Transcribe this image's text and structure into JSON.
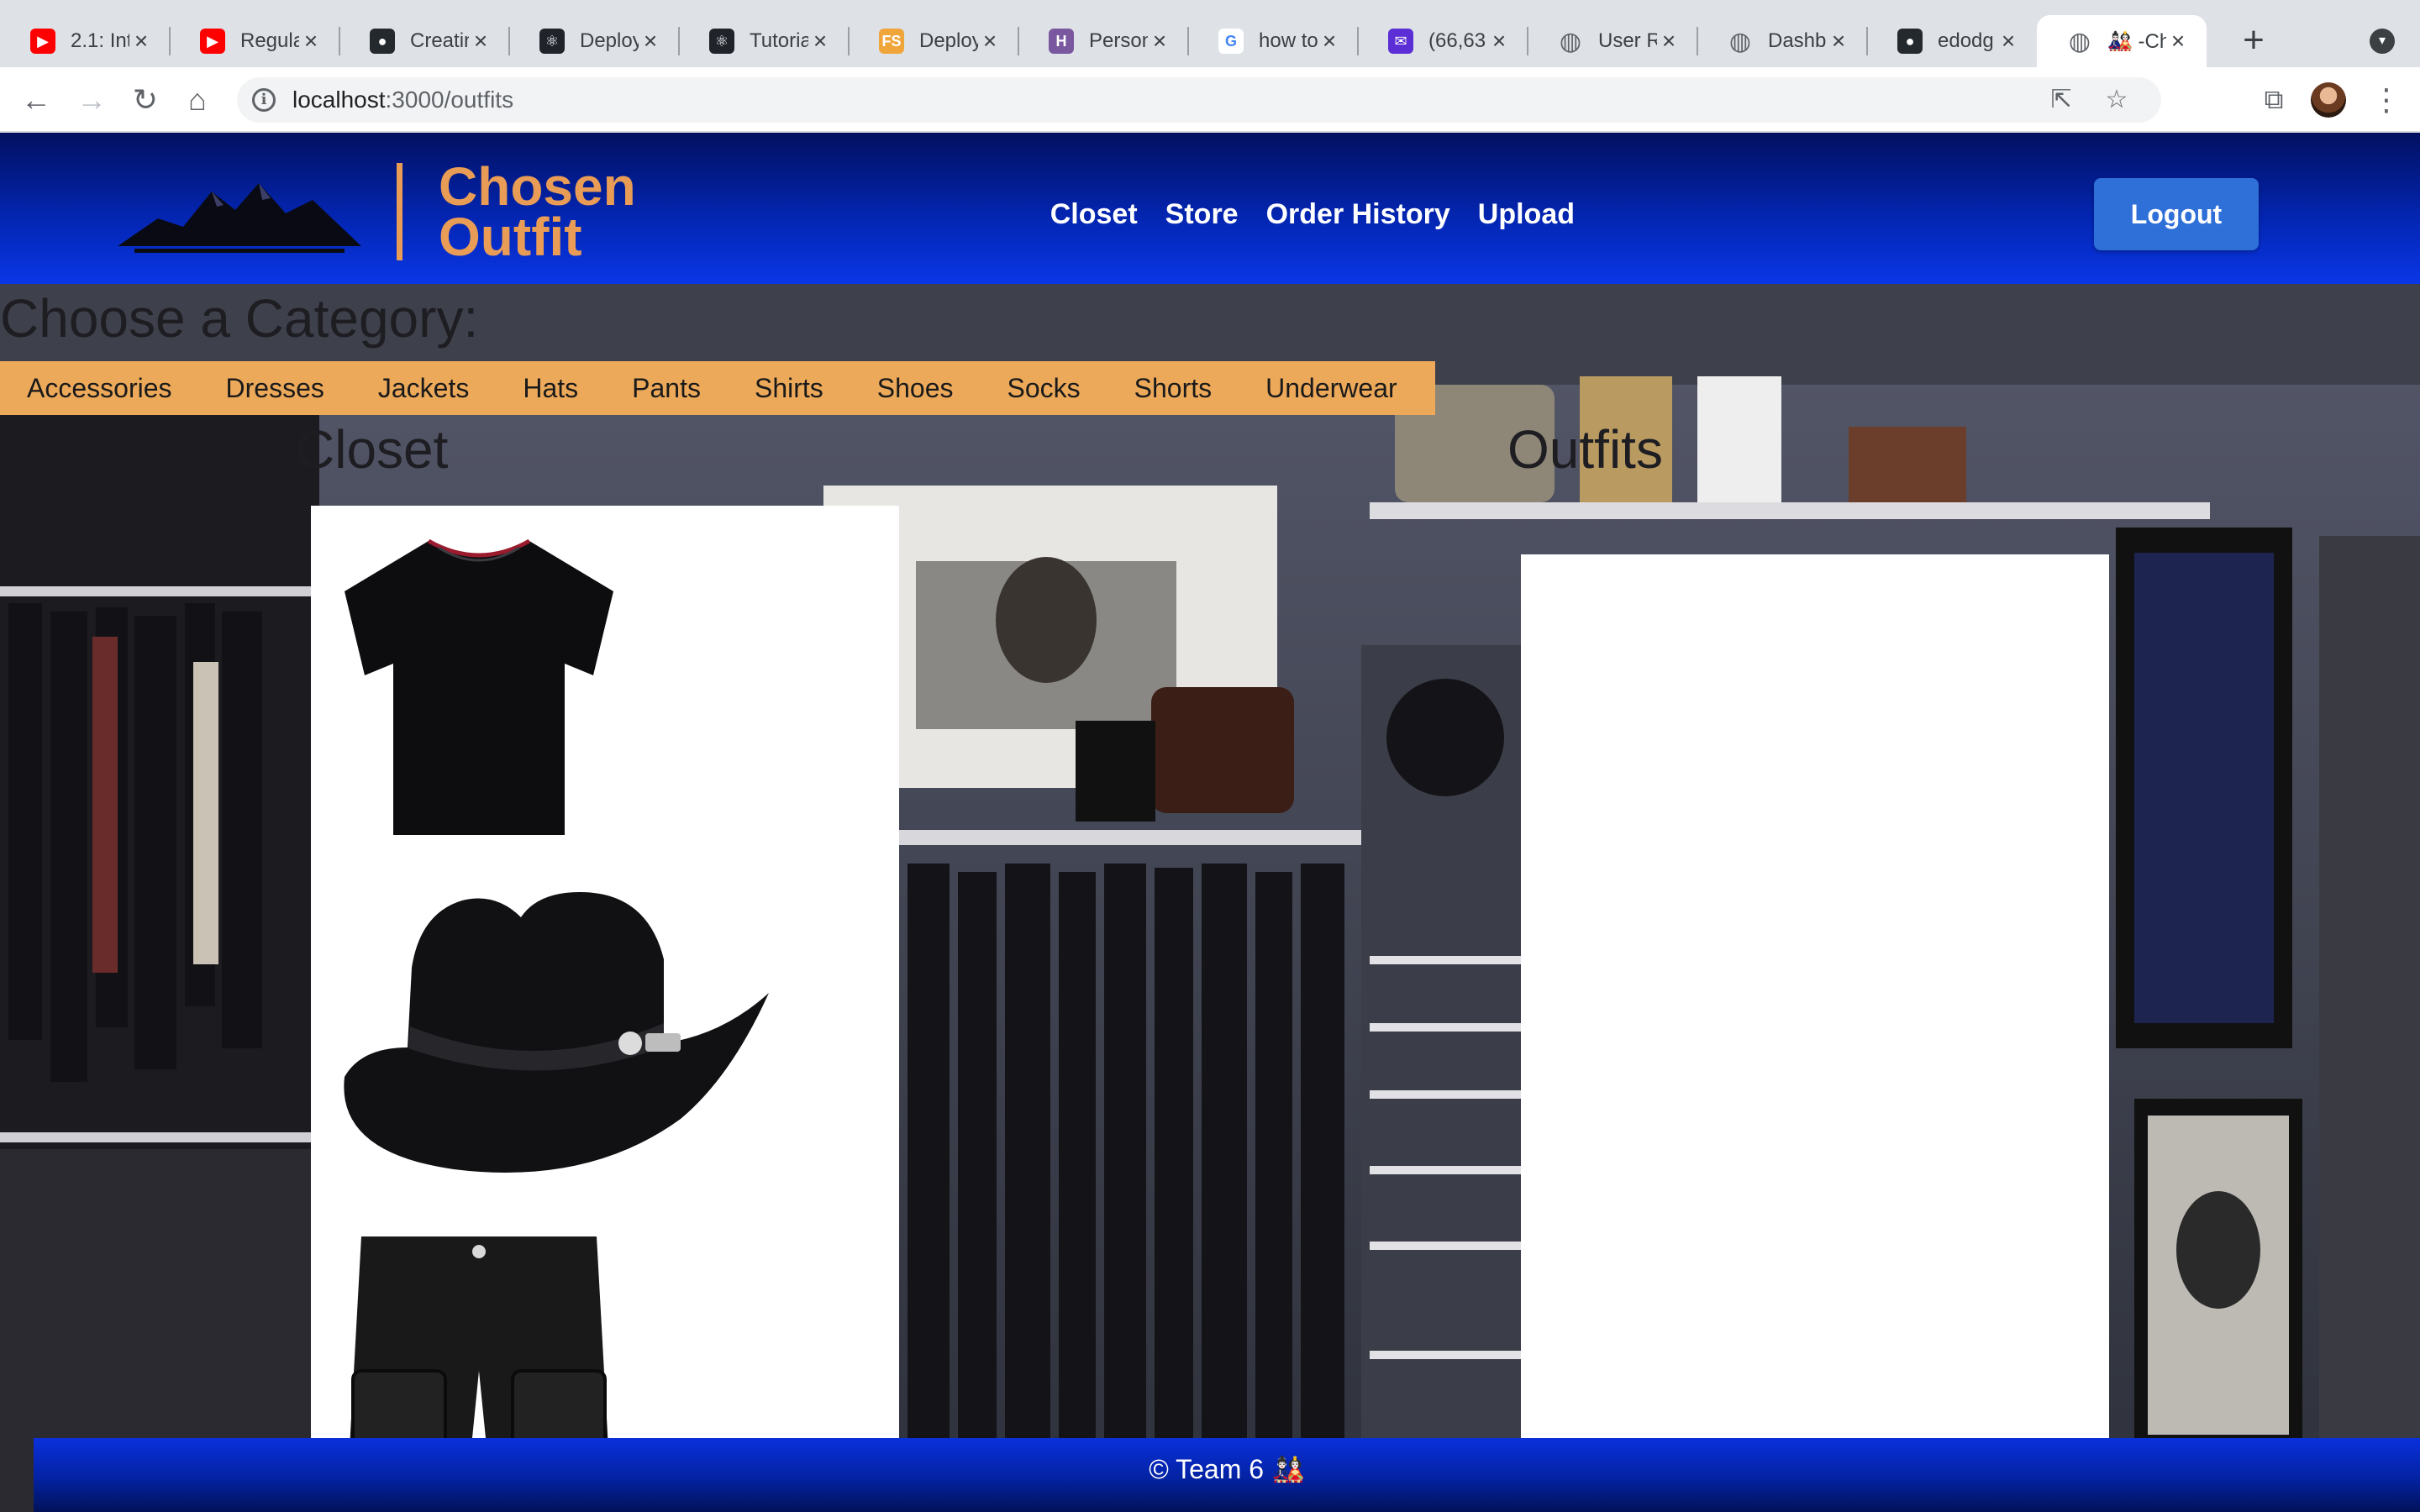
{
  "browser": {
    "tabs": [
      {
        "title": "2.1: Int",
        "icon": "youtube-icon",
        "color": "#ff0000"
      },
      {
        "title": "Regula",
        "icon": "youtube-icon",
        "color": "#ff0000"
      },
      {
        "title": "Creatin",
        "icon": "github-icon",
        "color": "#24292e"
      },
      {
        "title": "Deploy",
        "icon": "react-icon",
        "color": "#20232a"
      },
      {
        "title": "Tutoria",
        "icon": "react-icon",
        "color": "#20232a"
      },
      {
        "title": "Deploy",
        "icon": "fullstack-icon",
        "color": "#f0a53a"
      },
      {
        "title": "Person",
        "icon": "heroku-icon",
        "color": "#79589f"
      },
      {
        "title": "how to",
        "icon": "google-icon",
        "color": "#4285f4"
      },
      {
        "title": "(66,63",
        "icon": "mail-icon",
        "color": "#5c2ed6"
      },
      {
        "title": "User R",
        "icon": "globe-icon",
        "color": "#5f6368"
      },
      {
        "title": "Dashb",
        "icon": "globe-icon",
        "color": "#5f6368"
      },
      {
        "title": "edodg",
        "icon": "github-icon",
        "color": "#24292e"
      },
      {
        "title": "🎎 -Ch",
        "icon": "globe-icon",
        "color": "#5f6368"
      }
    ],
    "url_host": "localhost",
    "url_rest": ":3000/outfits"
  },
  "app": {
    "brand_line1": "Chosen",
    "brand_line2": "Outfit",
    "nav": [
      "Closet",
      "Store",
      "Order History",
      "Upload"
    ],
    "logout_label": "Logout",
    "choose_label": "Choose a Category:",
    "categories": [
      "Accessories",
      "Dresses",
      "Jackets",
      "Hats",
      "Pants",
      "Shirts",
      "Shoes",
      "Socks",
      "Shorts",
      "Underwear"
    ],
    "closet_title": "Closet",
    "outfits_title": "Outfits",
    "closet_items": [
      "black-tshirt-image",
      "black-cowboy-hat-image",
      "black-cargo-shorts-image"
    ],
    "footer_text": "© Team 6 🎎"
  },
  "colors": {
    "header_blue": "#0325b0",
    "accent_orange": "#e89c55",
    "category_bar": "#eda95a",
    "logout_button": "#2f6fd8"
  }
}
